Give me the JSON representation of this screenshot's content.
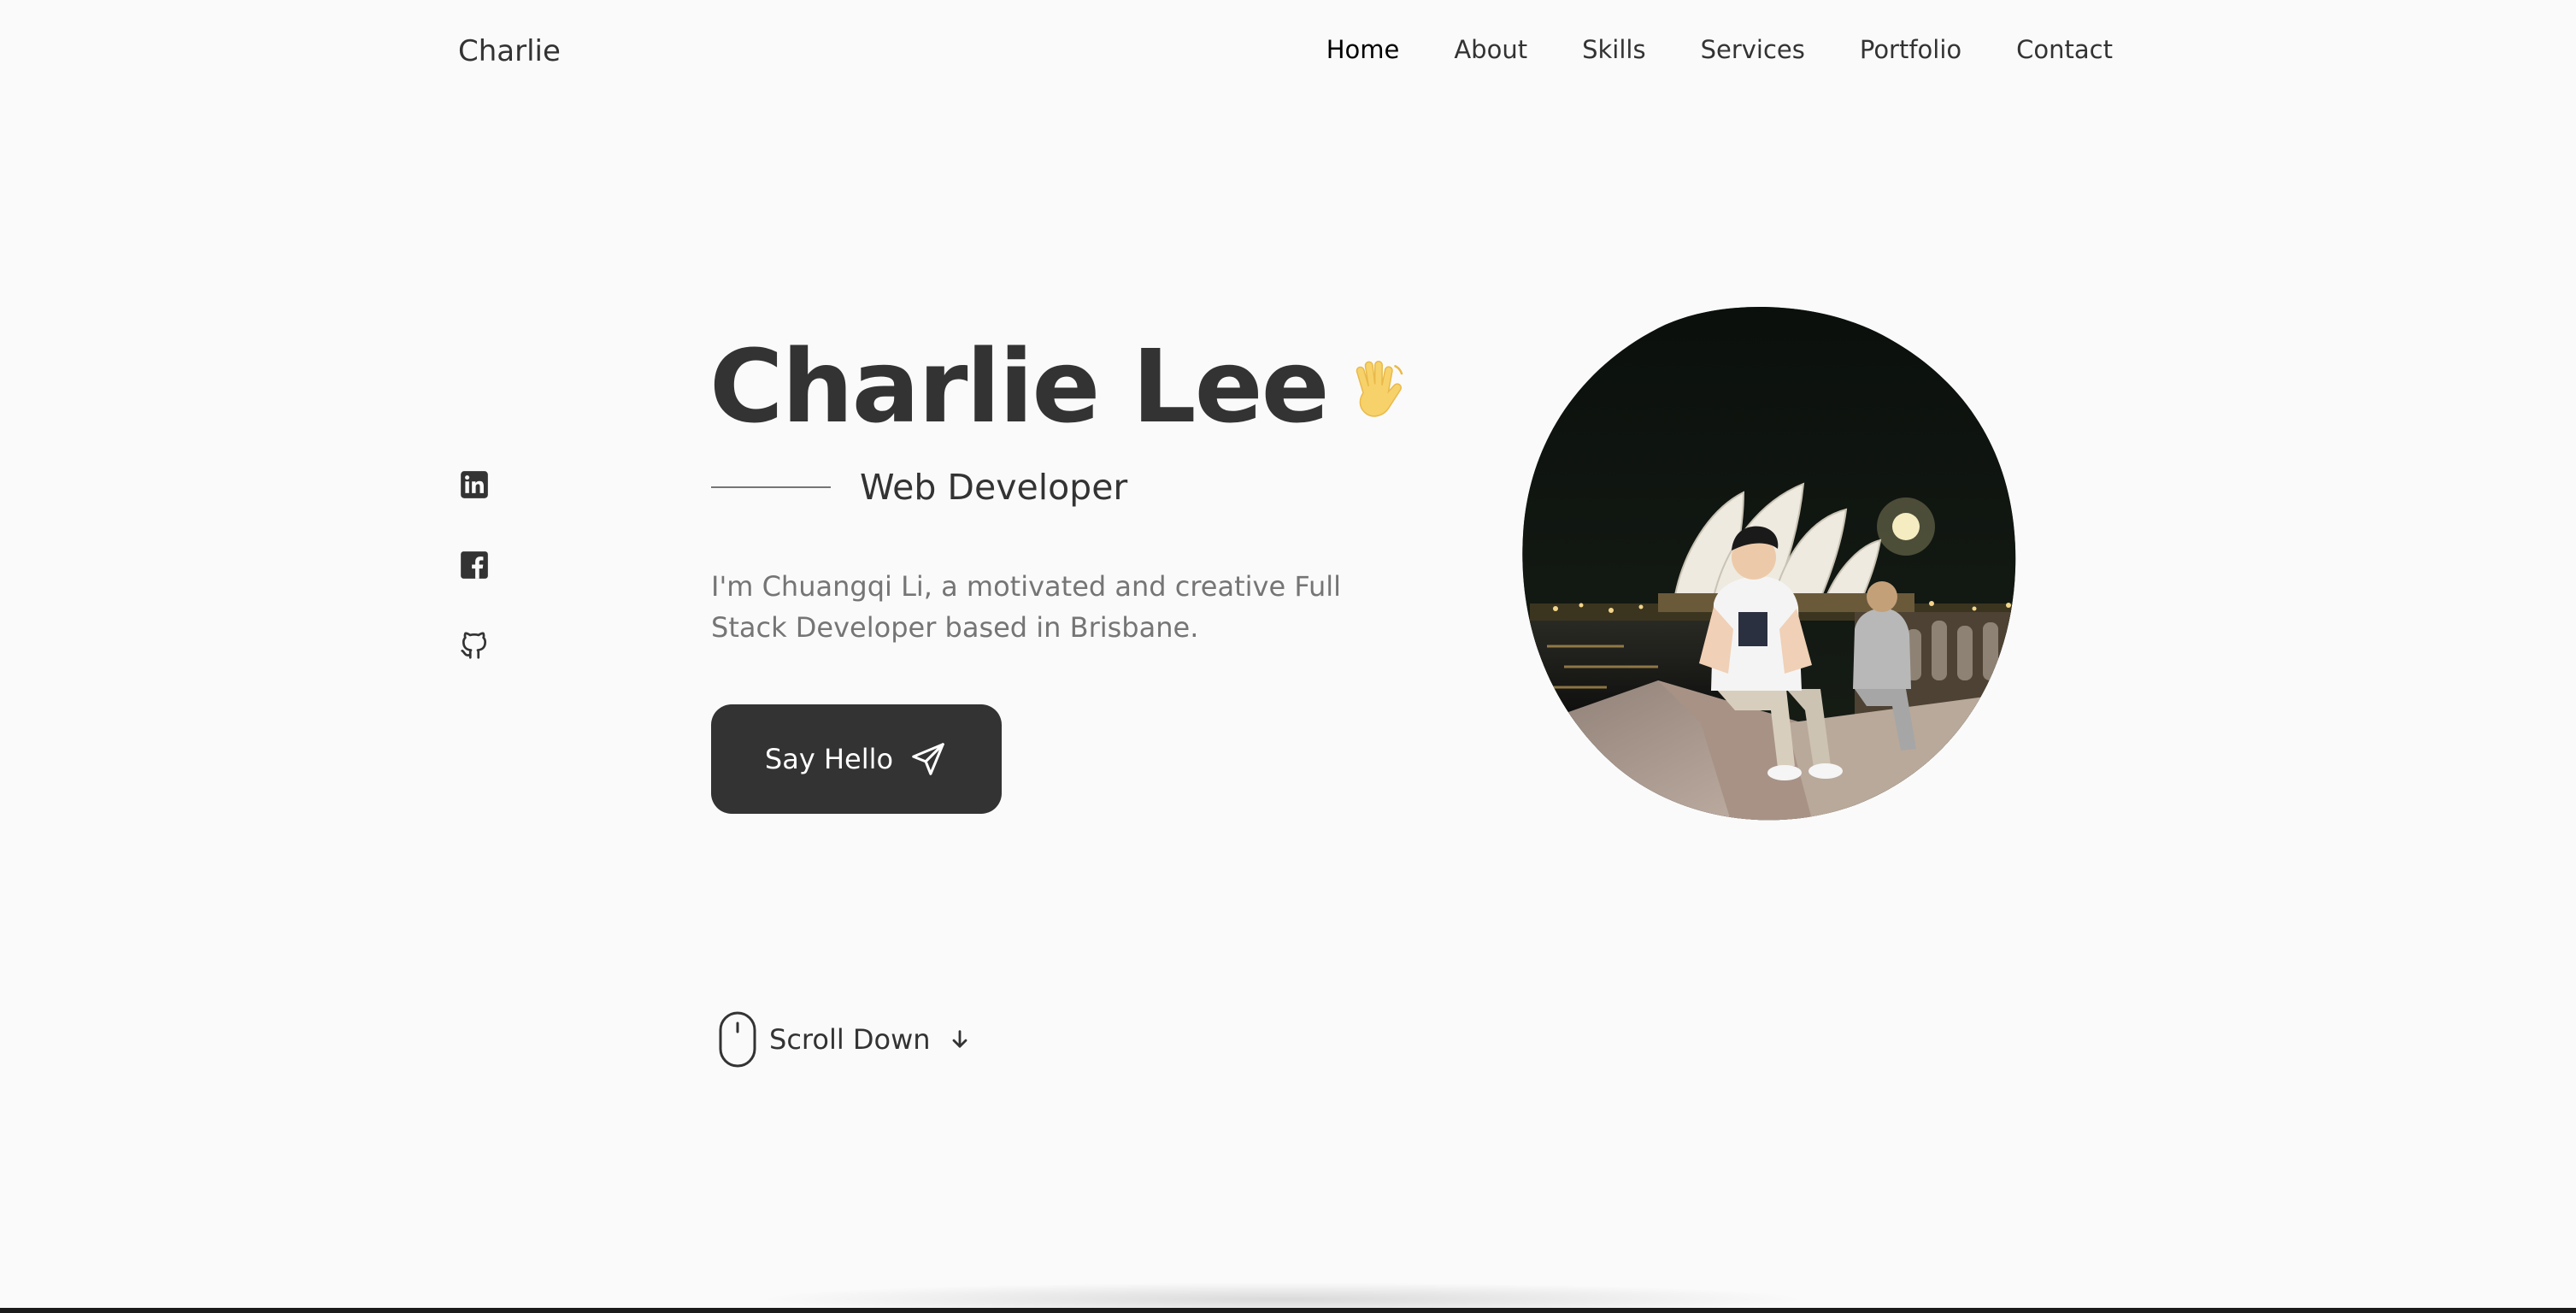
{
  "header": {
    "logo": "Charlie",
    "nav": [
      "Home",
      "About",
      "Skills",
      "Services",
      "Portfolio",
      "Contact"
    ],
    "active_nav": "Home"
  },
  "social": {
    "items": [
      "linkedin-icon",
      "facebook-icon",
      "github-icon"
    ]
  },
  "hero": {
    "name": "Charlie Lee",
    "wave_icon": "waving-hand-icon",
    "subtitle": "Web Developer",
    "description": "I'm Chuangqi Li, a motivated and creative Full Stack Developer based in Brisbane.",
    "button_label": "Say Hello",
    "button_icon": "send-icon"
  },
  "scroll": {
    "label": "Scroll Down",
    "icons": [
      "mouse-icon",
      "arrow-down-icon"
    ]
  },
  "colors": {
    "background": "#fafafa",
    "text_dark": "#333333",
    "text_muted": "#757575",
    "button_bg": "#333333",
    "blob_border": "#5b5d5e",
    "wave_yellow": "#f7d26a"
  }
}
